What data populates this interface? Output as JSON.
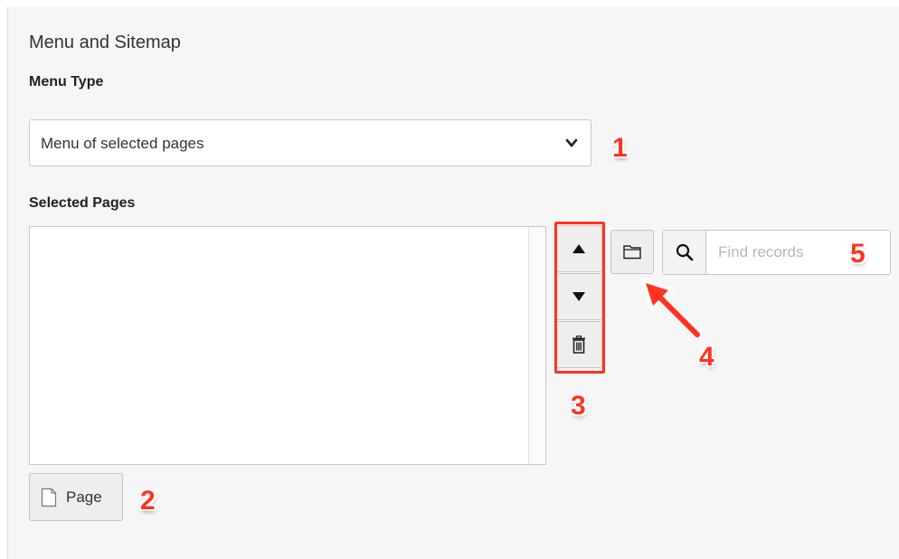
{
  "section": {
    "title": "Menu and Sitemap"
  },
  "menu_type": {
    "label": "Menu Type",
    "selected_value": "Menu of selected pages"
  },
  "selected_pages": {
    "label": "Selected Pages",
    "items": []
  },
  "buttons": {
    "page_label": "Page",
    "move_up_icon": "triangle-up-icon",
    "move_down_icon": "triangle-down-icon",
    "delete_icon": "trash-icon",
    "browse_icon": "folder-icon",
    "search_icon": "magnifier-icon"
  },
  "search": {
    "placeholder": "Find records",
    "value": ""
  },
  "callouts": {
    "one": "1",
    "two": "2",
    "three": "3",
    "four": "4",
    "five": "5"
  },
  "colors": {
    "callout_red": "#ff3320",
    "panel_background": "#f6f6f6",
    "button_background": "#eeeeee"
  }
}
